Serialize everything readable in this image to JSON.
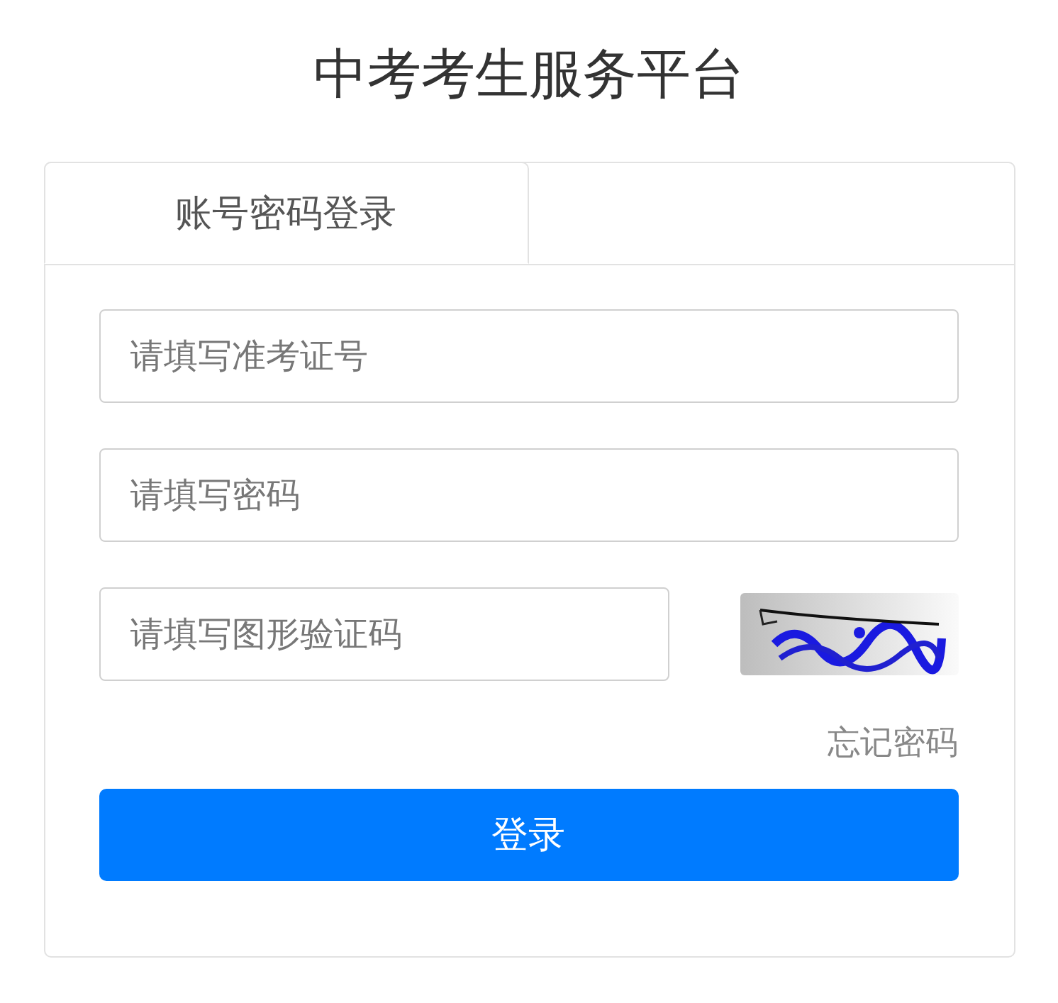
{
  "title": "中考考生服务平台",
  "tabs": [
    {
      "label": "账号密码登录",
      "selected": true
    }
  ],
  "fields": [
    {
      "placeholder": "请填写准考证号",
      "kind": "text"
    },
    {
      "placeholder": "请填写密码",
      "kind": "password"
    },
    {
      "placeholder": "请填写图形验证码",
      "kind": "captcha"
    }
  ],
  "forgot_link": "忘记密码",
  "submit_button": "登录"
}
